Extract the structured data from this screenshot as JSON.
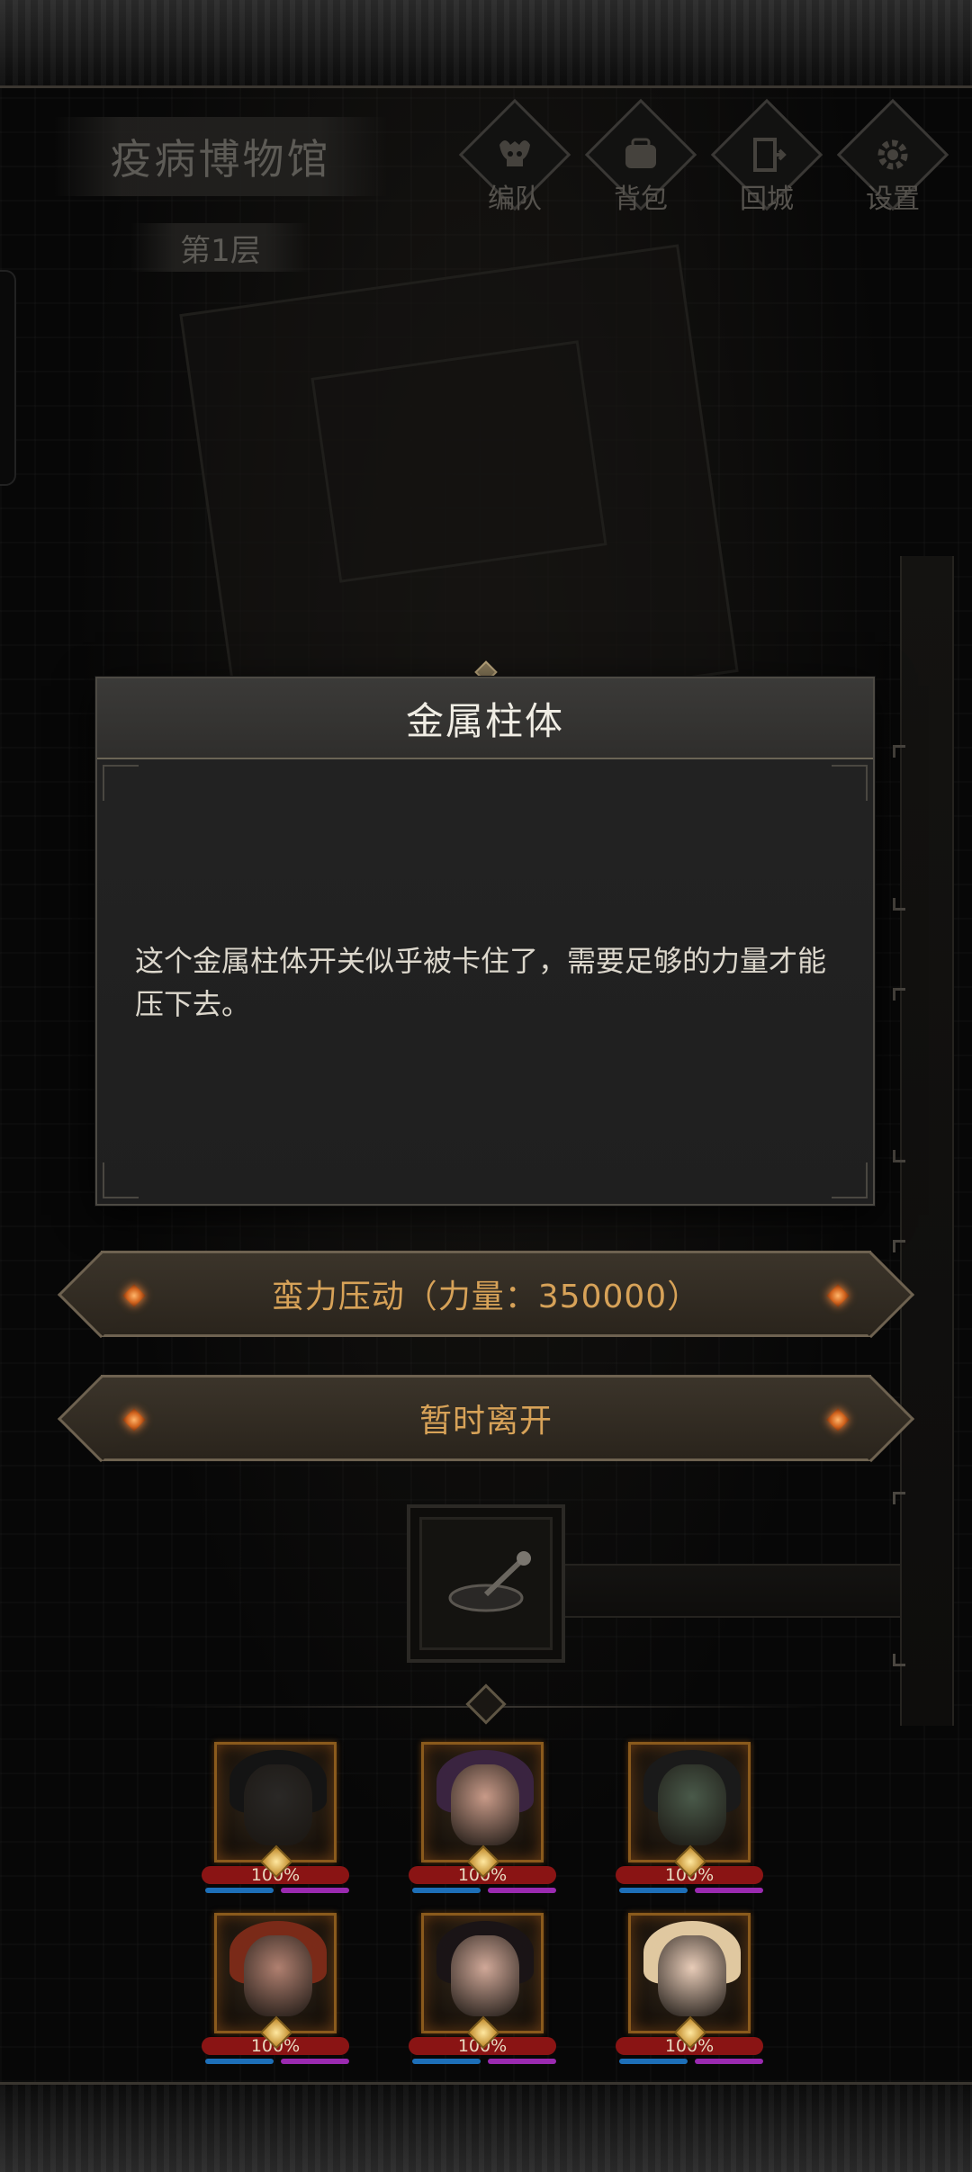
{
  "header": {
    "location": "疫病博物馆",
    "floor": "第1层",
    "menu": [
      {
        "label": "编队",
        "icon": "skull-icon"
      },
      {
        "label": "背包",
        "icon": "backpack-icon"
      },
      {
        "label": "回城",
        "icon": "door-icon"
      },
      {
        "label": "设置",
        "icon": "gear-icon"
      }
    ]
  },
  "dialog": {
    "title": "金属柱体",
    "body": "这个金属柱体开关似乎被卡住了，需要足够的力量才能压下去。"
  },
  "actions": {
    "force": "蛮力压动（力量：350000）",
    "leave": "暂时离开"
  },
  "party": [
    {
      "hp": "100%",
      "hp_fill": 1.0,
      "skin": "#2a2826",
      "hair": "#141414"
    },
    {
      "hp": "100%",
      "hp_fill": 1.0,
      "skin": "#c89a88",
      "hair": "#3a2440"
    },
    {
      "hp": "100%",
      "hp_fill": 1.0,
      "skin": "#4a5a4a",
      "hair": "#1a1a1a"
    },
    {
      "hp": "100%",
      "hp_fill": 1.0,
      "skin": "#b08070",
      "hair": "#7a2a18"
    },
    {
      "hp": "100%",
      "hp_fill": 1.0,
      "skin": "#d0a898",
      "hair": "#1a1416"
    },
    {
      "hp": "100%",
      "hp_fill": 1.0,
      "skin": "#e8ccb8",
      "hair": "#e0c8a0"
    }
  ],
  "colors": {
    "accent": "#d7a258",
    "gem": "#d2641e",
    "hp_bar": "#8a1414"
  }
}
